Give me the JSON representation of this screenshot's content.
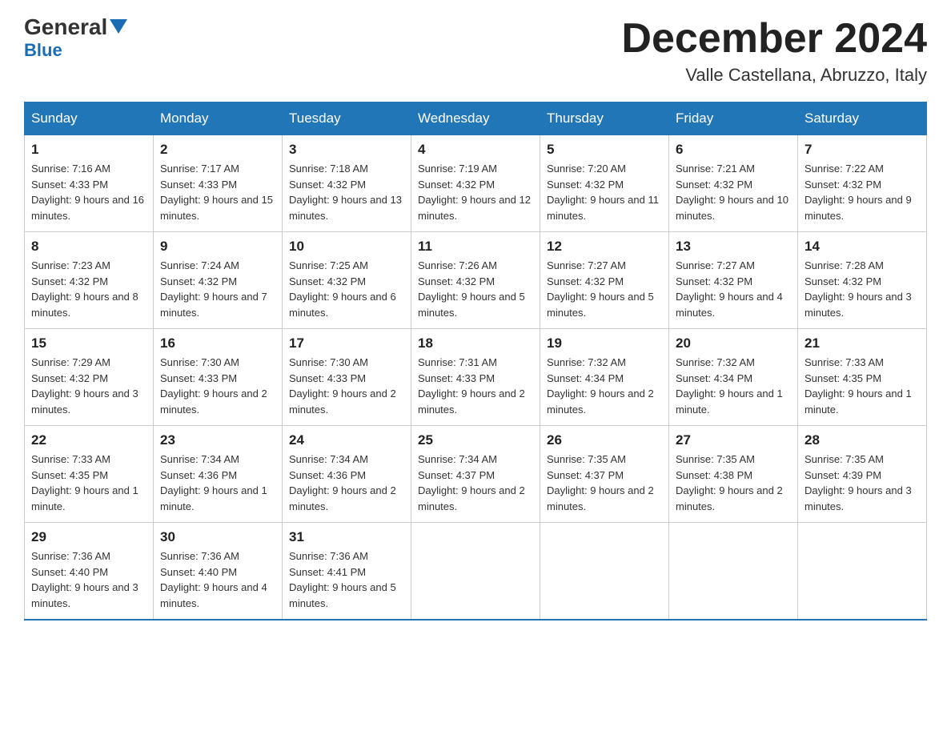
{
  "header": {
    "logo_text": "General",
    "logo_text2": "Blue",
    "month_title": "December 2024",
    "location": "Valle Castellana, Abruzzo, Italy"
  },
  "days_of_week": [
    "Sunday",
    "Monday",
    "Tuesday",
    "Wednesday",
    "Thursday",
    "Friday",
    "Saturday"
  ],
  "weeks": [
    [
      {
        "day": "1",
        "sunrise": "7:16 AM",
        "sunset": "4:33 PM",
        "daylight": "9 hours and 16 minutes."
      },
      {
        "day": "2",
        "sunrise": "7:17 AM",
        "sunset": "4:33 PM",
        "daylight": "9 hours and 15 minutes."
      },
      {
        "day": "3",
        "sunrise": "7:18 AM",
        "sunset": "4:32 PM",
        "daylight": "9 hours and 13 minutes."
      },
      {
        "day": "4",
        "sunrise": "7:19 AM",
        "sunset": "4:32 PM",
        "daylight": "9 hours and 12 minutes."
      },
      {
        "day": "5",
        "sunrise": "7:20 AM",
        "sunset": "4:32 PM",
        "daylight": "9 hours and 11 minutes."
      },
      {
        "day": "6",
        "sunrise": "7:21 AM",
        "sunset": "4:32 PM",
        "daylight": "9 hours and 10 minutes."
      },
      {
        "day": "7",
        "sunrise": "7:22 AM",
        "sunset": "4:32 PM",
        "daylight": "9 hours and 9 minutes."
      }
    ],
    [
      {
        "day": "8",
        "sunrise": "7:23 AM",
        "sunset": "4:32 PM",
        "daylight": "9 hours and 8 minutes."
      },
      {
        "day": "9",
        "sunrise": "7:24 AM",
        "sunset": "4:32 PM",
        "daylight": "9 hours and 7 minutes."
      },
      {
        "day": "10",
        "sunrise": "7:25 AM",
        "sunset": "4:32 PM",
        "daylight": "9 hours and 6 minutes."
      },
      {
        "day": "11",
        "sunrise": "7:26 AM",
        "sunset": "4:32 PM",
        "daylight": "9 hours and 5 minutes."
      },
      {
        "day": "12",
        "sunrise": "7:27 AM",
        "sunset": "4:32 PM",
        "daylight": "9 hours and 5 minutes."
      },
      {
        "day": "13",
        "sunrise": "7:27 AM",
        "sunset": "4:32 PM",
        "daylight": "9 hours and 4 minutes."
      },
      {
        "day": "14",
        "sunrise": "7:28 AM",
        "sunset": "4:32 PM",
        "daylight": "9 hours and 3 minutes."
      }
    ],
    [
      {
        "day": "15",
        "sunrise": "7:29 AM",
        "sunset": "4:32 PM",
        "daylight": "9 hours and 3 minutes."
      },
      {
        "day": "16",
        "sunrise": "7:30 AM",
        "sunset": "4:33 PM",
        "daylight": "9 hours and 2 minutes."
      },
      {
        "day": "17",
        "sunrise": "7:30 AM",
        "sunset": "4:33 PM",
        "daylight": "9 hours and 2 minutes."
      },
      {
        "day": "18",
        "sunrise": "7:31 AM",
        "sunset": "4:33 PM",
        "daylight": "9 hours and 2 minutes."
      },
      {
        "day": "19",
        "sunrise": "7:32 AM",
        "sunset": "4:34 PM",
        "daylight": "9 hours and 2 minutes."
      },
      {
        "day": "20",
        "sunrise": "7:32 AM",
        "sunset": "4:34 PM",
        "daylight": "9 hours and 1 minute."
      },
      {
        "day": "21",
        "sunrise": "7:33 AM",
        "sunset": "4:35 PM",
        "daylight": "9 hours and 1 minute."
      }
    ],
    [
      {
        "day": "22",
        "sunrise": "7:33 AM",
        "sunset": "4:35 PM",
        "daylight": "9 hours and 1 minute."
      },
      {
        "day": "23",
        "sunrise": "7:34 AM",
        "sunset": "4:36 PM",
        "daylight": "9 hours and 1 minute."
      },
      {
        "day": "24",
        "sunrise": "7:34 AM",
        "sunset": "4:36 PM",
        "daylight": "9 hours and 2 minutes."
      },
      {
        "day": "25",
        "sunrise": "7:34 AM",
        "sunset": "4:37 PM",
        "daylight": "9 hours and 2 minutes."
      },
      {
        "day": "26",
        "sunrise": "7:35 AM",
        "sunset": "4:37 PM",
        "daylight": "9 hours and 2 minutes."
      },
      {
        "day": "27",
        "sunrise": "7:35 AM",
        "sunset": "4:38 PM",
        "daylight": "9 hours and 2 minutes."
      },
      {
        "day": "28",
        "sunrise": "7:35 AM",
        "sunset": "4:39 PM",
        "daylight": "9 hours and 3 minutes."
      }
    ],
    [
      {
        "day": "29",
        "sunrise": "7:36 AM",
        "sunset": "4:40 PM",
        "daylight": "9 hours and 3 minutes."
      },
      {
        "day": "30",
        "sunrise": "7:36 AM",
        "sunset": "4:40 PM",
        "daylight": "9 hours and 4 minutes."
      },
      {
        "day": "31",
        "sunrise": "7:36 AM",
        "sunset": "4:41 PM",
        "daylight": "9 hours and 5 minutes."
      },
      null,
      null,
      null,
      null
    ]
  ]
}
